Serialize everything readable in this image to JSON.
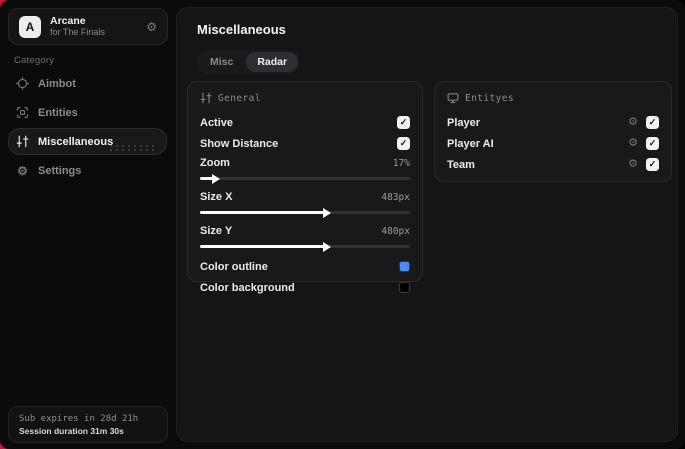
{
  "theme": {
    "accent_red": "#cb1245",
    "panel_bg": "#19191b",
    "checkbox_bg": "#f2f2f2"
  },
  "sidebar": {
    "brand": {
      "initial": "A",
      "title": "Arcane",
      "subtitle": "for The Finals"
    },
    "category_label": "Category",
    "items": [
      {
        "label": "Aimbot",
        "icon": "crosshair-icon",
        "active": false
      },
      {
        "label": "Entities",
        "icon": "scan-icon",
        "active": false
      },
      {
        "label": "Miscellaneous",
        "icon": "sliders-icon",
        "active": true
      },
      {
        "label": "Settings",
        "icon": "gear-icon",
        "active": false
      }
    ],
    "footer": {
      "line1": "Sub expires in 28d 21h",
      "line2": "Session duration 31m 30s"
    }
  },
  "main": {
    "title": "Miscellaneous",
    "tabs": [
      {
        "label": "Misc",
        "active": false
      },
      {
        "label": "Radar",
        "active": true
      }
    ],
    "general": {
      "title": "General",
      "icon": "sliders-icon",
      "toggles": [
        {
          "label": "Active",
          "checked": true
        },
        {
          "label": "Show Distance",
          "checked": true
        }
      ],
      "sliders": [
        {
          "label": "Zoom",
          "value": "17%",
          "percent": 7
        },
        {
          "label": "Size X",
          "value": "483px",
          "percent": 60
        },
        {
          "label": "Size Y",
          "value": "480px",
          "percent": 60
        }
      ],
      "colors": [
        {
          "label": "Color outline",
          "swatch": "#4a8cf7"
        },
        {
          "label": "Color background",
          "swatch": "#000000"
        }
      ]
    },
    "entities": {
      "title": "Entityes",
      "icon": "monitor-icon",
      "rows": [
        {
          "label": "Player",
          "checked": true
        },
        {
          "label": "Player AI",
          "checked": true
        },
        {
          "label": "Team",
          "checked": true
        }
      ]
    }
  }
}
